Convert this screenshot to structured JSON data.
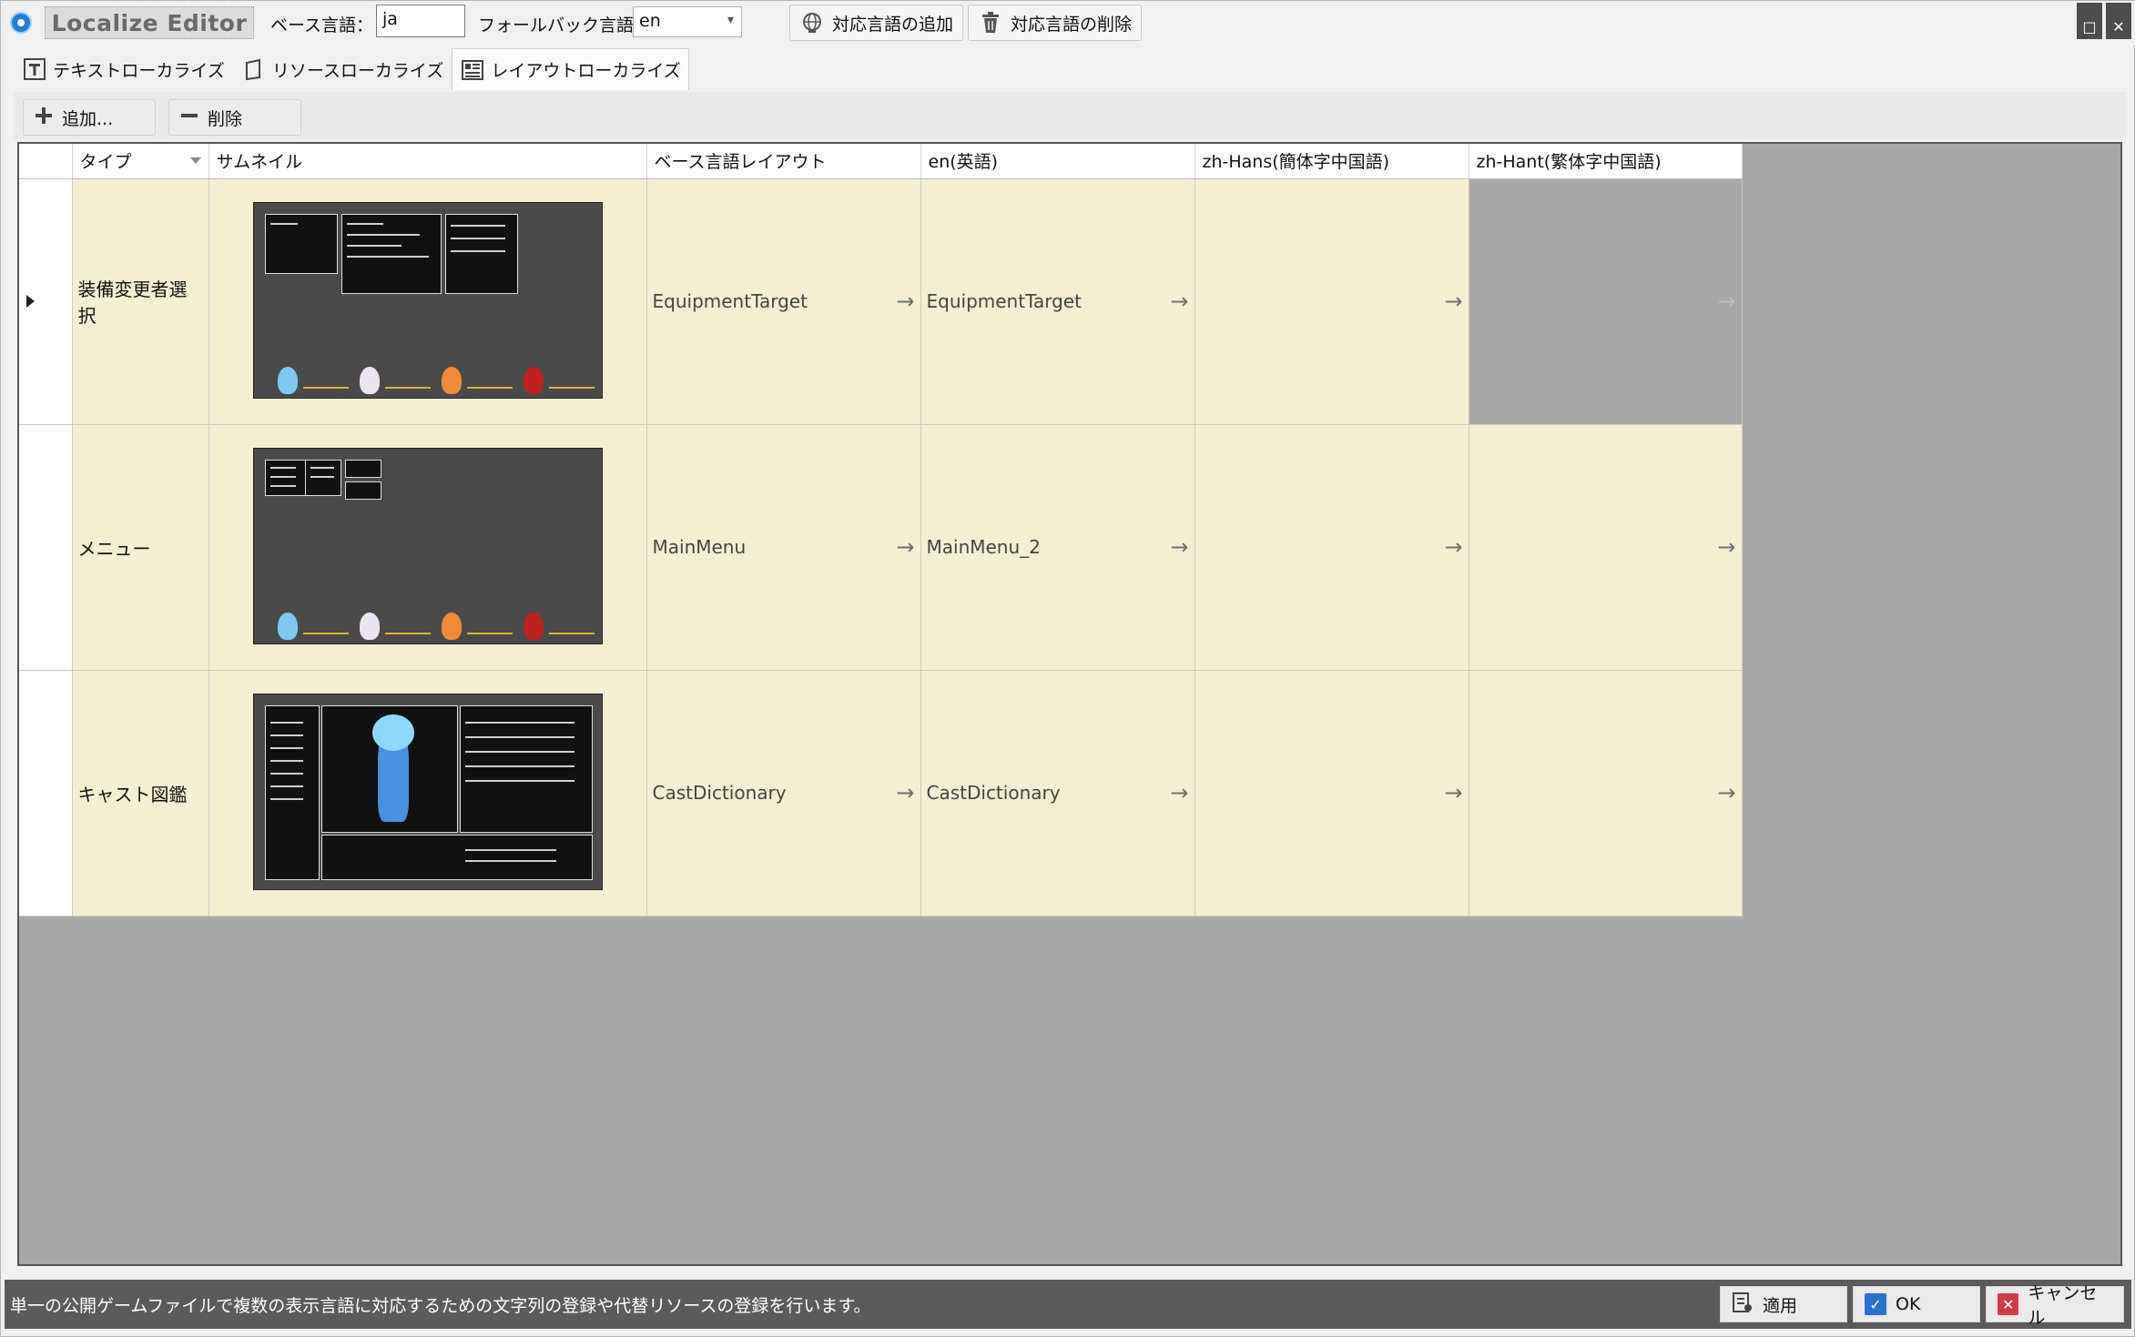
{
  "app": {
    "title": "Localize Editor"
  },
  "toolbar": {
    "base_lang_label": "ベース言語：",
    "base_lang_value": "ja",
    "fallback_label": "フォールバック言語：",
    "fallback_value": "en",
    "add_lang_label": "対応言語の追加",
    "remove_lang_label": "対応言語の削除"
  },
  "tabs": [
    {
      "label": "テキストローカライズ",
      "icon": "text-T-icon"
    },
    {
      "label": "リソースローカライズ",
      "icon": "resource-icon"
    },
    {
      "label": "レイアウトローカライズ",
      "icon": "layout-icon",
      "active": true
    }
  ],
  "subbar": {
    "add_label": "追加...",
    "delete_label": "削除"
  },
  "grid": {
    "columns": [
      "タイプ",
      "サムネイル",
      "ベース言語レイアウト",
      "en(英語)",
      "zh-Hans(簡体字中国語)",
      "zh-Hant(繁体字中国語)"
    ],
    "arrow_symbol": "→",
    "rows": [
      {
        "type": "装備変更者選択",
        "base": "EquipmentTarget",
        "en": "EquipmentTarget",
        "zh_hans": "",
        "zh_hant": "",
        "selected": true
      },
      {
        "type": "メニュー",
        "base": "MainMenu",
        "en": "MainMenu_2",
        "zh_hans": "",
        "zh_hant": ""
      },
      {
        "type": "キャスト図鑑",
        "base": "CastDictionary",
        "en": "CastDictionary",
        "zh_hans": "",
        "zh_hant": ""
      }
    ]
  },
  "status": {
    "message": "単一の公開ゲームファイルで複数の表示言語に対応するための文字列の登録や代替リソースの登録を行います。"
  },
  "footer": {
    "apply_label": "適用",
    "ok_label": "OK",
    "cancel_label": "キャンセル"
  },
  "colors": {
    "row_bg": "#f4efd3",
    "grid_bg": "#a8a8a8",
    "status_bg": "#5b5b5b",
    "accent": "#2b6fd0"
  }
}
